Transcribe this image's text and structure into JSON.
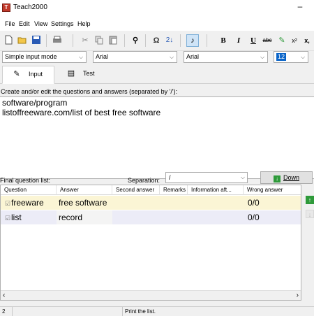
{
  "window": {
    "title": "Teach2000",
    "minimize": "–"
  },
  "menu": [
    "File",
    "Edit",
    "View",
    "Settings",
    "Help"
  ],
  "toolbar": {
    "bold": "B",
    "italic": "I",
    "underline": "U",
    "strike": "abc",
    "superscript": "x²",
    "subscript": "x,"
  },
  "combos": {
    "mode": "Simple input mode",
    "font1": "Arial",
    "font2": "Arial",
    "size": "12"
  },
  "tabs": {
    "input": "Input",
    "test": "Test"
  },
  "editor": {
    "label": "Create and/or edit the questions and answers (separated by '/'):",
    "lines": [
      "software/program",
      "listoffreeware.com/list of best free software"
    ]
  },
  "list": {
    "label": "Final question list:",
    "separation_label": "Separation:",
    "separation_value": "/",
    "down_button": "Down"
  },
  "grid": {
    "headers": [
      "Question",
      "Answer",
      "Second answer",
      "Remarks",
      "Information aft...",
      "Wrong answer"
    ],
    "rows": [
      {
        "question": "freeware",
        "answer": "free software",
        "wrong": "0/0"
      },
      {
        "question": "list",
        "answer": "record",
        "wrong": "0/0"
      }
    ]
  },
  "status": {
    "left": "2",
    "hint": "Print the list."
  }
}
